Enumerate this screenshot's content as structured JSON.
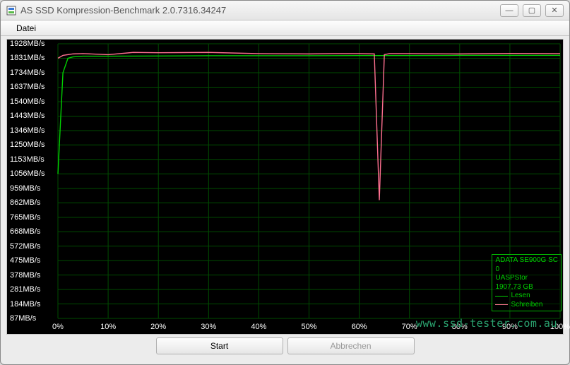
{
  "window": {
    "title": "AS SSD Kompression-Benchmark 2.0.7316.34247",
    "controls": {
      "minimize": "—",
      "maximize": "▢",
      "close": "✕"
    }
  },
  "menu": {
    "file": "Datei"
  },
  "buttons": {
    "start": "Start",
    "cancel": "Abbrechen"
  },
  "legend": {
    "device": "ADATA SE900G SC",
    "device2": "0",
    "driver": "UASPStor",
    "size": "1907,73 GB",
    "read": "Lesen",
    "write": "Schreiben"
  },
  "watermark": "www.ssd-tester.com.au",
  "chart_data": {
    "type": "line",
    "title": "",
    "xlabel": "",
    "ylabel": "",
    "xlim": [
      0,
      100
    ],
    "ylim": [
      87,
      1928
    ],
    "x_ticks": [
      0,
      10,
      20,
      30,
      40,
      50,
      60,
      70,
      80,
      90,
      100
    ],
    "x_tick_labels": [
      "0%",
      "10%",
      "20%",
      "30%",
      "40%",
      "50%",
      "60%",
      "70%",
      "80%",
      "90%",
      "100%"
    ],
    "y_ticks": [
      87,
      184,
      281,
      378,
      475,
      572,
      668,
      765,
      862,
      959,
      1056,
      1153,
      1250,
      1346,
      1443,
      1540,
      1637,
      1734,
      1831,
      1928
    ],
    "y_tick_labels": [
      "87MB/s",
      "184MB/s",
      "281MB/s",
      "378MB/s",
      "475MB/s",
      "572MB/s",
      "668MB/s",
      "765MB/s",
      "862MB/s",
      "959MB/s",
      "1056MB/s",
      "1153MB/s",
      "1250MB/s",
      "1346MB/s",
      "1443MB/s",
      "1540MB/s",
      "1637MB/s",
      "1734MB/s",
      "1831MB/s",
      "1928MB/s"
    ],
    "series": [
      {
        "name": "Lesen",
        "color": "#00d000",
        "x": [
          0,
          1,
          2,
          3,
          5,
          10,
          20,
          30,
          40,
          50,
          60,
          70,
          80,
          90,
          100
        ],
        "values": [
          1056,
          1734,
          1831,
          1840,
          1845,
          1845,
          1846,
          1848,
          1848,
          1848,
          1849,
          1849,
          1850,
          1850,
          1850
        ]
      },
      {
        "name": "Schreiben",
        "color": "#ff7090",
        "x": [
          0,
          1,
          3,
          5,
          10,
          15,
          20,
          30,
          40,
          50,
          55,
          60,
          63,
          64,
          65,
          66,
          70,
          80,
          90,
          100
        ],
        "values": [
          1831,
          1850,
          1860,
          1862,
          1855,
          1870,
          1868,
          1870,
          1862,
          1860,
          1862,
          1862,
          1860,
          880,
          1855,
          1862,
          1862,
          1860,
          1863,
          1862
        ]
      }
    ]
  }
}
